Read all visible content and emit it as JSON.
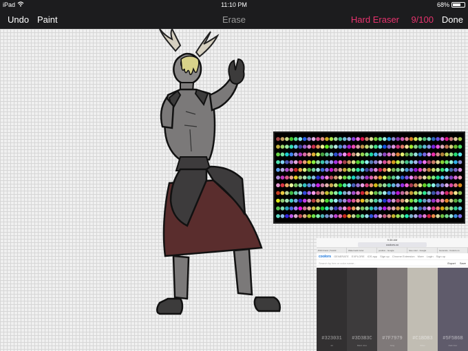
{
  "status_bar": {
    "device": "iPad",
    "time": "11:10 PM",
    "battery_text": "68%",
    "battery_level": 0.68
  },
  "toolbar": {
    "undo": "Undo",
    "paint": "Paint",
    "mode": "Erase",
    "tool": "Hard Eraser",
    "size": "9/100",
    "done": "Done",
    "accent_color": "#e8336e"
  },
  "browser": {
    "status_time": "9:38 AM",
    "url": "coolors.co",
    "tabs": [
      "POD brand | Tumblr",
      "Watermark Color",
      "positive - Google",
      "fave color - Google",
      "Generate - Coolors.co"
    ],
    "logo": "coolors",
    "links": [
      "GENERATE",
      "EXPLORE",
      "iOS app",
      "Sign up",
      "Chrome Extension",
      "More",
      "Login",
      "Sign up"
    ],
    "search_placeholder": "Search by hex or color name...",
    "controls": [
      "Export",
      "Save"
    ],
    "palette": [
      {
        "hex": "#323031",
        "name": "Jet"
      },
      {
        "hex": "#3D3B3C",
        "name": "Black olive"
      },
      {
        "hex": "#7F7979",
        "name": "Gray"
      },
      {
        "hex": "#C1BDB3",
        "name": "Silver"
      },
      {
        "hex": "#5F5B6B",
        "name": "Dark liver"
      }
    ]
  }
}
